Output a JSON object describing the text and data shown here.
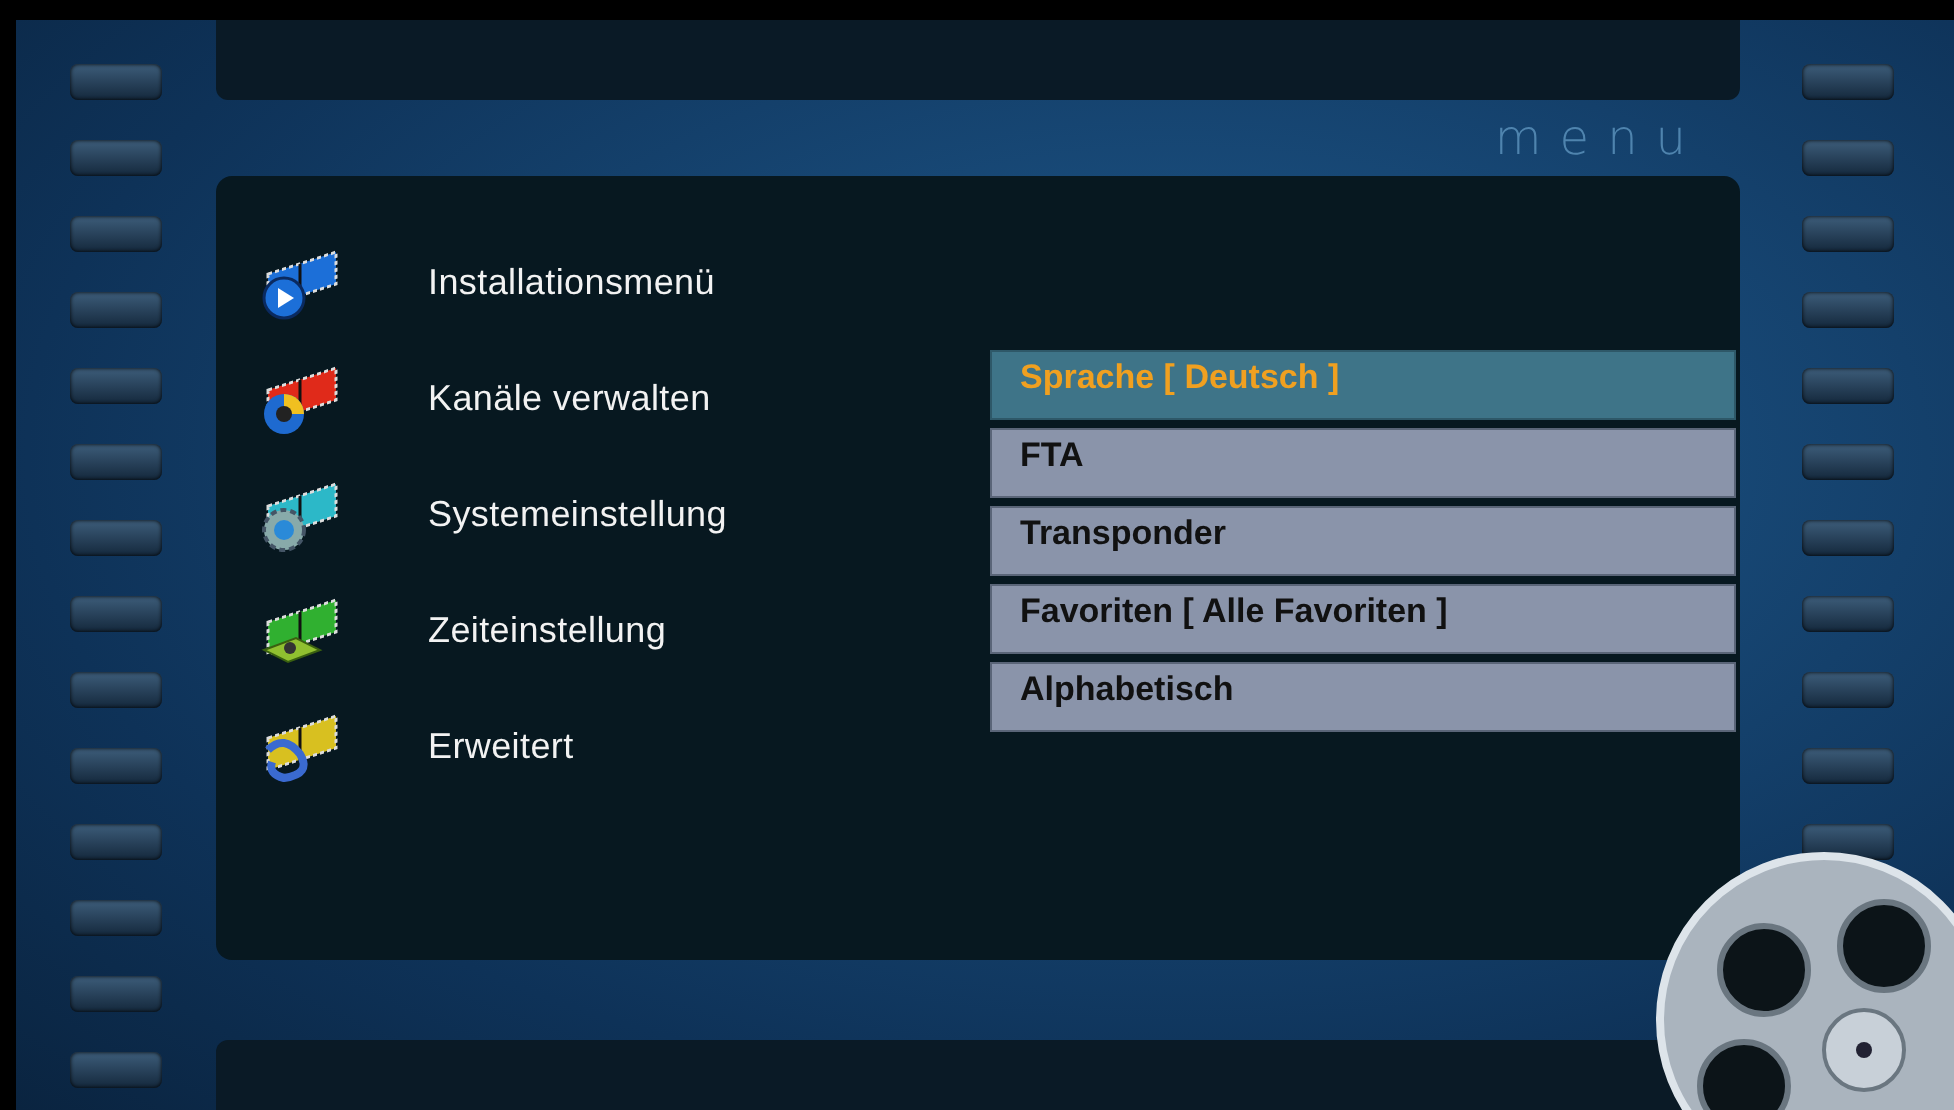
{
  "logo": "menu",
  "main_menu": [
    {
      "label": "Installationsmenü"
    },
    {
      "label": "Kanäle verwalten"
    },
    {
      "label": "Systemeinstellung"
    },
    {
      "label": "Zeiteinstellung"
    },
    {
      "label": "Erweitert"
    }
  ],
  "submenu": [
    {
      "label": "Sprache [ Deutsch ]",
      "selected": true
    },
    {
      "label": "FTA",
      "selected": false
    },
    {
      "label": "Transponder",
      "selected": false
    },
    {
      "label": "Favoriten [ Alle Favoriten ]",
      "selected": false
    },
    {
      "label": "Alphabetisch",
      "selected": false
    }
  ]
}
